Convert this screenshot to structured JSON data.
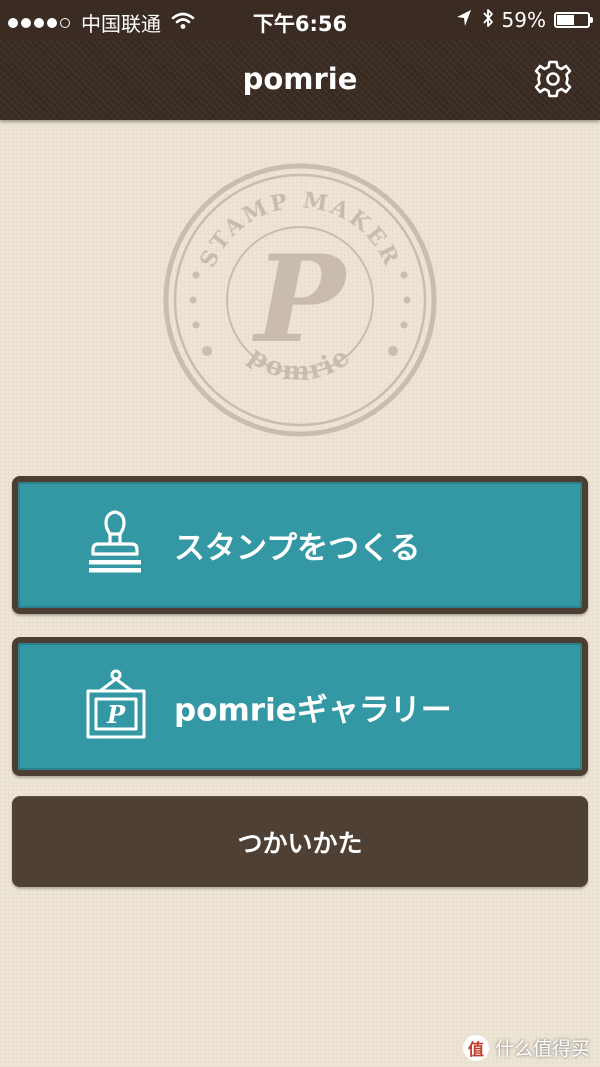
{
  "status_bar": {
    "signal_bars_filled": 4,
    "signal_bars_total": 5,
    "carrier": "中国联通",
    "time": "下午6:56",
    "battery_percent": "59%",
    "battery_level": 0.59,
    "icons": [
      "signal-dots-icon",
      "wifi-icon",
      "location-arrow-icon",
      "bluetooth-icon",
      "battery-icon"
    ]
  },
  "nav": {
    "title": "pomrie",
    "settings_icon": "gear-icon"
  },
  "logo": {
    "top_text": "STAMP MAKER",
    "letter": "P",
    "bottom_text": "pomrie"
  },
  "buttons": {
    "create": {
      "label": "スタンプをつくる",
      "icon": "stamp-icon"
    },
    "gallery": {
      "label": "pomrieギャラリー",
      "icon": "picture-frame-icon"
    },
    "howto": {
      "label": "つかいかた"
    }
  },
  "watermark": {
    "logo": "值",
    "text": "什么值得买"
  },
  "colors": {
    "nav_bg": "#3b2c23",
    "page_bg": "#ede5d6",
    "teal": "#3398a4",
    "dark_brown": "#4f4035",
    "logo_ink": "#c9bcac"
  }
}
